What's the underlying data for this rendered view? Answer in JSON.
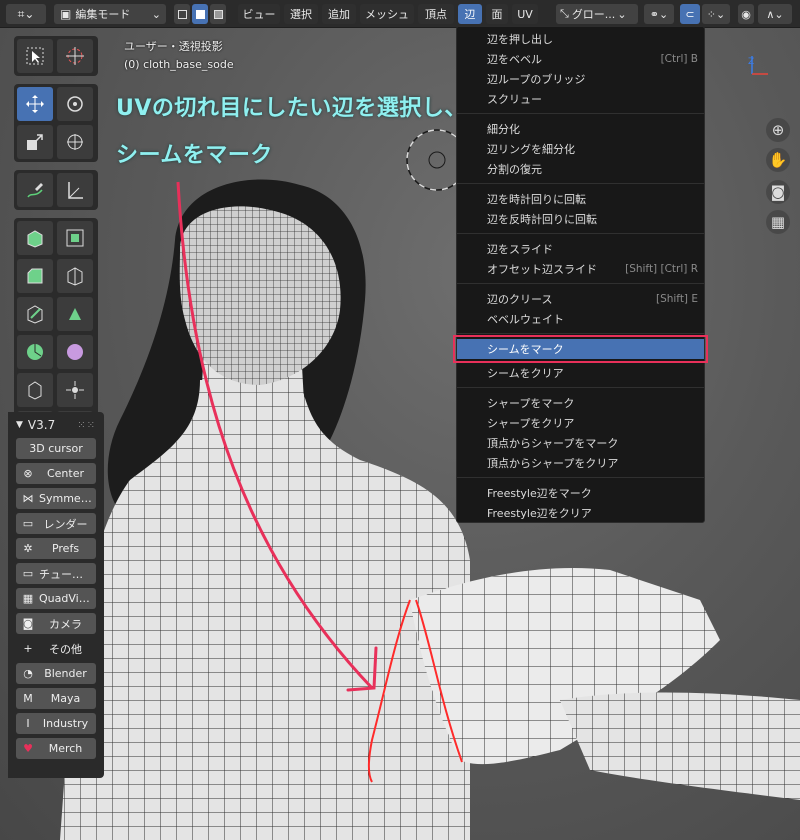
{
  "header": {
    "mode_select": "編集モード",
    "menus": [
      "ビュー",
      "選択",
      "追加",
      "メッシュ",
      "頂点",
      "辺",
      "面",
      "UV"
    ],
    "active_menu": "辺",
    "transform_orientation": "グロー..."
  },
  "viewport": {
    "view_name": "ユーザー・透視投影",
    "object_name": "(0) cloth_base_sode"
  },
  "annotation": {
    "line1": "UVの切れ目にしたい辺を選択し、",
    "line2": "シームをマーク",
    "accent_color": "#e8305a",
    "text_color": "#8ff0f0"
  },
  "npanel": {
    "version": "V3.7",
    "buttons": [
      {
        "label": "3D cursor",
        "icon": ""
      },
      {
        "label": "Center",
        "icon": "center-icon"
      },
      {
        "label": "Symmetry",
        "icon": "symmetry-icon"
      },
      {
        "label": "レンダー",
        "icon": "render-icon"
      },
      {
        "label": "Prefs",
        "icon": "gear-icon"
      },
      {
        "label": "チュート...",
        "icon": "monitor-icon"
      },
      {
        "label": "QuadView",
        "icon": "grid-icon"
      },
      {
        "label": "カメラ",
        "icon": "camera-icon"
      },
      {
        "label": "その他",
        "icon": "plus-icon"
      },
      {
        "label": "Blender",
        "icon": "blender-icon"
      },
      {
        "label": "Maya",
        "icon": "maya-icon"
      },
      {
        "label": "Industry",
        "icon": "industry-icon"
      },
      {
        "label": "Merch",
        "icon": "heart-icon"
      }
    ]
  },
  "edge_menu": {
    "groups": [
      [
        {
          "label": "辺を押し出し",
          "shortcut": ""
        },
        {
          "label": "辺をベベル",
          "shortcut": "[Ctrl] B"
        },
        {
          "label": "辺ループのブリッジ",
          "shortcut": ""
        },
        {
          "label": "スクリュー",
          "shortcut": ""
        }
      ],
      [
        {
          "label": "細分化",
          "shortcut": ""
        },
        {
          "label": "辺リングを細分化",
          "shortcut": ""
        },
        {
          "label": "分割の復元",
          "shortcut": ""
        }
      ],
      [
        {
          "label": "辺を時計回りに回転",
          "shortcut": ""
        },
        {
          "label": "辺を反時計回りに回転",
          "shortcut": ""
        }
      ],
      [
        {
          "label": "辺をスライド",
          "shortcut": ""
        },
        {
          "label": "オフセット辺スライド",
          "shortcut": "[Shift] [Ctrl] R"
        }
      ],
      [
        {
          "label": "辺のクリース",
          "shortcut": "[Shift] E"
        },
        {
          "label": "ベベルウェイト",
          "shortcut": ""
        }
      ],
      [
        {
          "label": "シームをマーク",
          "shortcut": "",
          "highlighted": true
        },
        {
          "label": "シームをクリア",
          "shortcut": ""
        }
      ],
      [
        {
          "label": "シャープをマーク",
          "shortcut": ""
        },
        {
          "label": "シャープをクリア",
          "shortcut": ""
        },
        {
          "label": "頂点からシャープをマーク",
          "shortcut": ""
        },
        {
          "label": "頂点からシャープをクリア",
          "shortcut": ""
        }
      ],
      [
        {
          "label": "Freestyle辺をマーク",
          "shortcut": ""
        },
        {
          "label": "Freestyle辺をクリア",
          "shortcut": ""
        }
      ]
    ]
  },
  "colors": {
    "menu_highlight": "#4772b3",
    "seam": "#ff2a2a"
  }
}
